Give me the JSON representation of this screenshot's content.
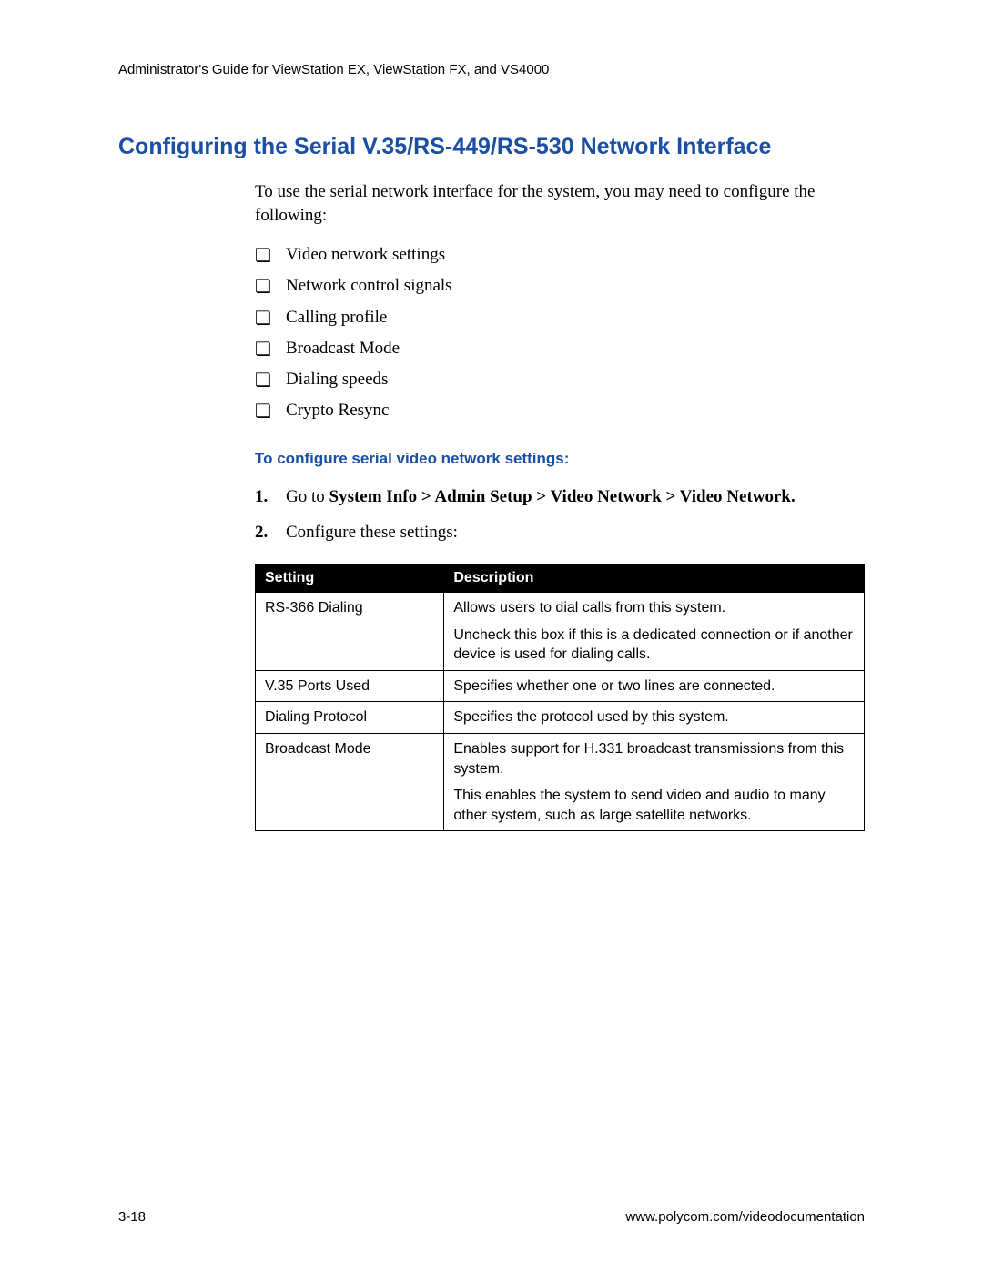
{
  "header": {
    "running": "Administrator's Guide for ViewStation EX, ViewStation FX, and VS4000"
  },
  "section": {
    "title": "Configuring the Serial V.35/RS-449/RS-530 Network Interface",
    "intro": "To use the serial network interface for the system, you may need to configure the following:",
    "checklist": [
      "Video network settings",
      "Network control signals",
      "Calling profile",
      "Broadcast Mode",
      "Dialing speeds",
      "Crypto Resync"
    ],
    "subheading": "To configure serial video network settings:",
    "steps": {
      "step1_prefix": "Go to ",
      "step1_path": "System Info > Admin Setup > Video Network > Video Network.",
      "step2": "Configure these settings:"
    }
  },
  "table": {
    "headers": {
      "setting": "Setting",
      "description": "Description"
    },
    "rows": [
      {
        "setting": "RS-366 Dialing",
        "description": [
          "Allows users to dial calls from this system.",
          "Uncheck this box if this is a dedicated connection or if another device is used for dialing calls."
        ]
      },
      {
        "setting": "V.35 Ports Used",
        "description": [
          "Specifies whether one or two lines are connected."
        ]
      },
      {
        "setting": "Dialing Protocol",
        "description": [
          "Specifies the protocol used by this system."
        ]
      },
      {
        "setting": "Broadcast Mode",
        "description": [
          "Enables support for H.331 broadcast transmissions from this system.",
          "This enables the system to send video and audio to many other system, such as large satellite networks."
        ]
      }
    ]
  },
  "footer": {
    "pagenum": "3-18",
    "url": "www.polycom.com/videodocumentation"
  }
}
